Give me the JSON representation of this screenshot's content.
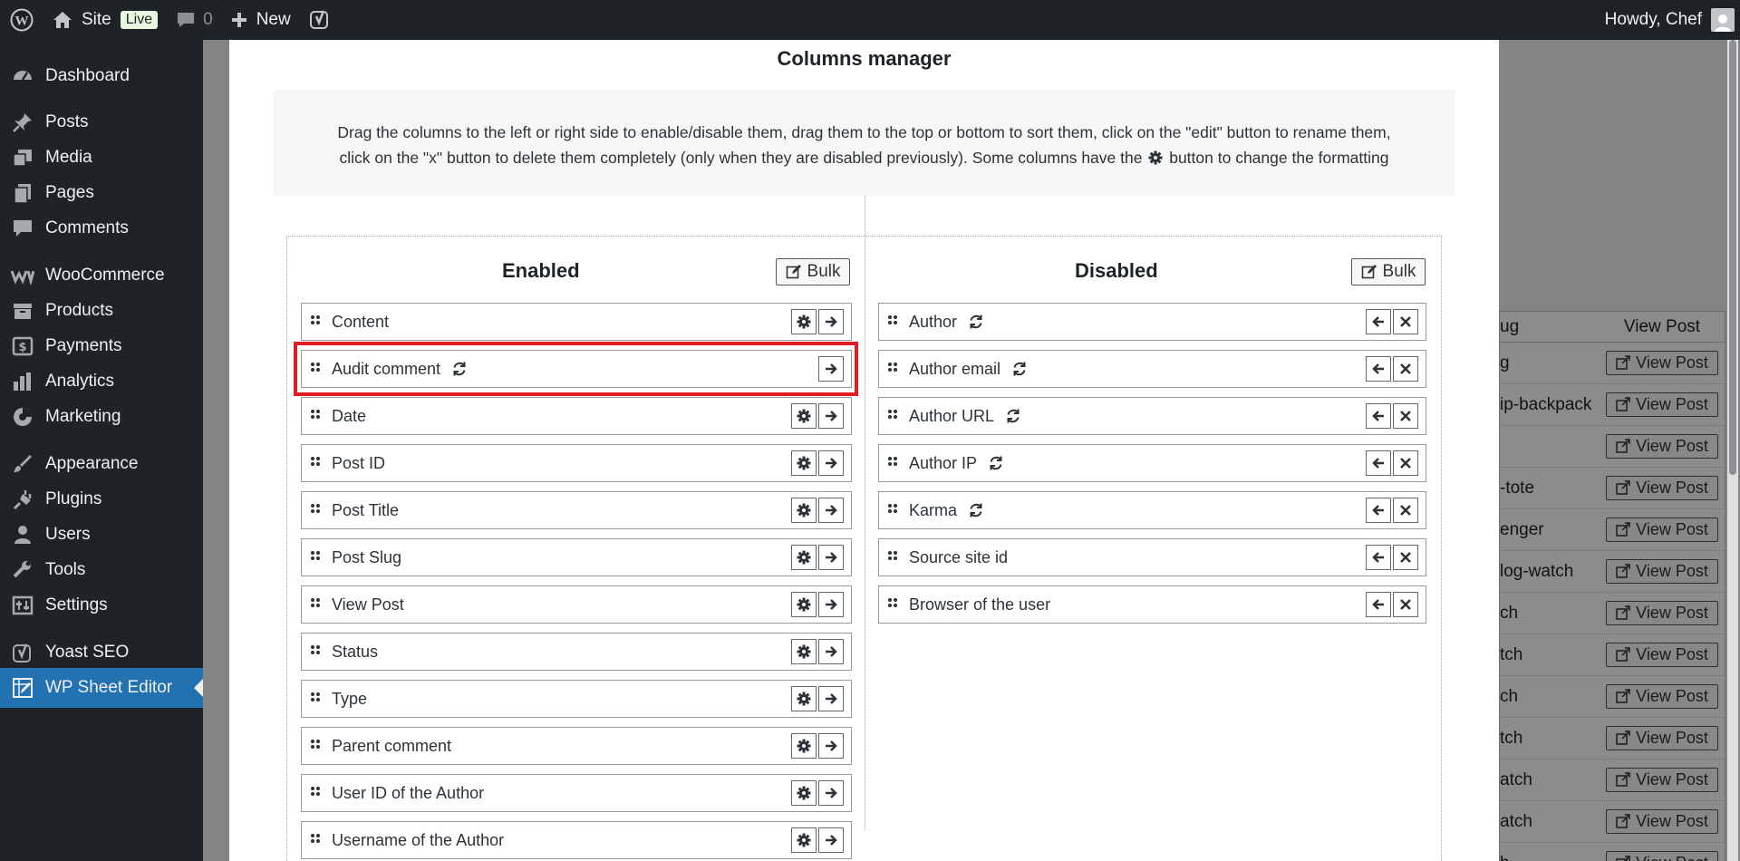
{
  "adminbar": {
    "site_label": "Site",
    "live_badge": "Live",
    "comments_count": "0",
    "new_label": "New",
    "greeting": "Howdy, Chef"
  },
  "sidebar": {
    "items": [
      {
        "label": "Dashboard",
        "icon": "dashboard-icon"
      },
      {
        "label": "Posts",
        "icon": "pin-icon"
      },
      {
        "label": "Media",
        "icon": "media-icon"
      },
      {
        "label": "Pages",
        "icon": "pages-icon"
      },
      {
        "label": "Comments",
        "icon": "comments-icon"
      },
      {
        "label": "WooCommerce",
        "icon": "woocommerce-icon"
      },
      {
        "label": "Products",
        "icon": "products-icon"
      },
      {
        "label": "Payments",
        "icon": "payments-icon"
      },
      {
        "label": "Analytics",
        "icon": "analytics-icon"
      },
      {
        "label": "Marketing",
        "icon": "marketing-icon"
      },
      {
        "label": "Appearance",
        "icon": "appearance-icon"
      },
      {
        "label": "Plugins",
        "icon": "plugins-icon"
      },
      {
        "label": "Users",
        "icon": "users-icon"
      },
      {
        "label": "Tools",
        "icon": "tools-icon"
      },
      {
        "label": "Settings",
        "icon": "settings-icon"
      },
      {
        "label": "Yoast SEO",
        "icon": "yoast-icon"
      },
      {
        "label": "WP Sheet Editor",
        "icon": "sheet-editor-icon"
      }
    ]
  },
  "background_table": {
    "header_partial": "ug",
    "header_view": "View Post",
    "rows": [
      {
        "slug": "g",
        "button": "View Post"
      },
      {
        "slug": "ip-backpack",
        "button": "View Post"
      },
      {
        "slug": "",
        "button": "View Post"
      },
      {
        "slug": "-tote",
        "button": "View Post"
      },
      {
        "slug": "enger",
        "button": "View Post"
      },
      {
        "slug": "log-watch",
        "button": "View Post"
      },
      {
        "slug": "ch",
        "button": "View Post"
      },
      {
        "slug": "tch",
        "button": "View Post"
      },
      {
        "slug": "ch",
        "button": "View Post"
      },
      {
        "slug": "tch",
        "button": "View Post"
      },
      {
        "slug": "atch",
        "button": "View Post"
      },
      {
        "slug": "atch",
        "button": "View Post"
      },
      {
        "slug": "h",
        "button": "View Post"
      }
    ]
  },
  "modal": {
    "title": "Columns manager",
    "instructions_line1": "Drag the columns to the left or right side to enable/disable them, drag them to the top or bottom to sort them, click on the \"edit\" button to rename them,",
    "instructions_line2a": "click on the \"x\" button to delete them completely (only when they are disabled previously). Some columns have the",
    "instructions_line2b": "button to change the formatting",
    "enabled_title": "Enabled",
    "disabled_title": "Disabled",
    "bulk_label": "Bulk",
    "enabled": [
      {
        "label": "Content",
        "refresh": false,
        "gear": true
      },
      {
        "label": "Audit comment",
        "refresh": true,
        "gear": false
      },
      {
        "label": "Date",
        "refresh": false,
        "gear": true
      },
      {
        "label": "Post ID",
        "refresh": false,
        "gear": true
      },
      {
        "label": "Post Title",
        "refresh": false,
        "gear": true
      },
      {
        "label": "Post Slug",
        "refresh": false,
        "gear": true
      },
      {
        "label": "View Post",
        "refresh": false,
        "gear": true
      },
      {
        "label": "Status",
        "refresh": false,
        "gear": true
      },
      {
        "label": "Type",
        "refresh": false,
        "gear": true
      },
      {
        "label": "Parent comment",
        "refresh": false,
        "gear": true
      },
      {
        "label": "User ID of the Author",
        "refresh": false,
        "gear": true
      },
      {
        "label": "Username of the Author",
        "refresh": false,
        "gear": true
      }
    ],
    "disabled": [
      {
        "label": "Author",
        "refresh": true
      },
      {
        "label": "Author email",
        "refresh": true
      },
      {
        "label": "Author URL",
        "refresh": true
      },
      {
        "label": "Author IP",
        "refresh": true
      },
      {
        "label": "Karma",
        "refresh": true
      },
      {
        "label": "Source site id",
        "refresh": false
      },
      {
        "label": "Browser of the user",
        "refresh": false
      }
    ]
  },
  "colors": {
    "admin_dark": "#1d2327",
    "current_menu": "#2271b1",
    "highlight": "#e01b24"
  }
}
